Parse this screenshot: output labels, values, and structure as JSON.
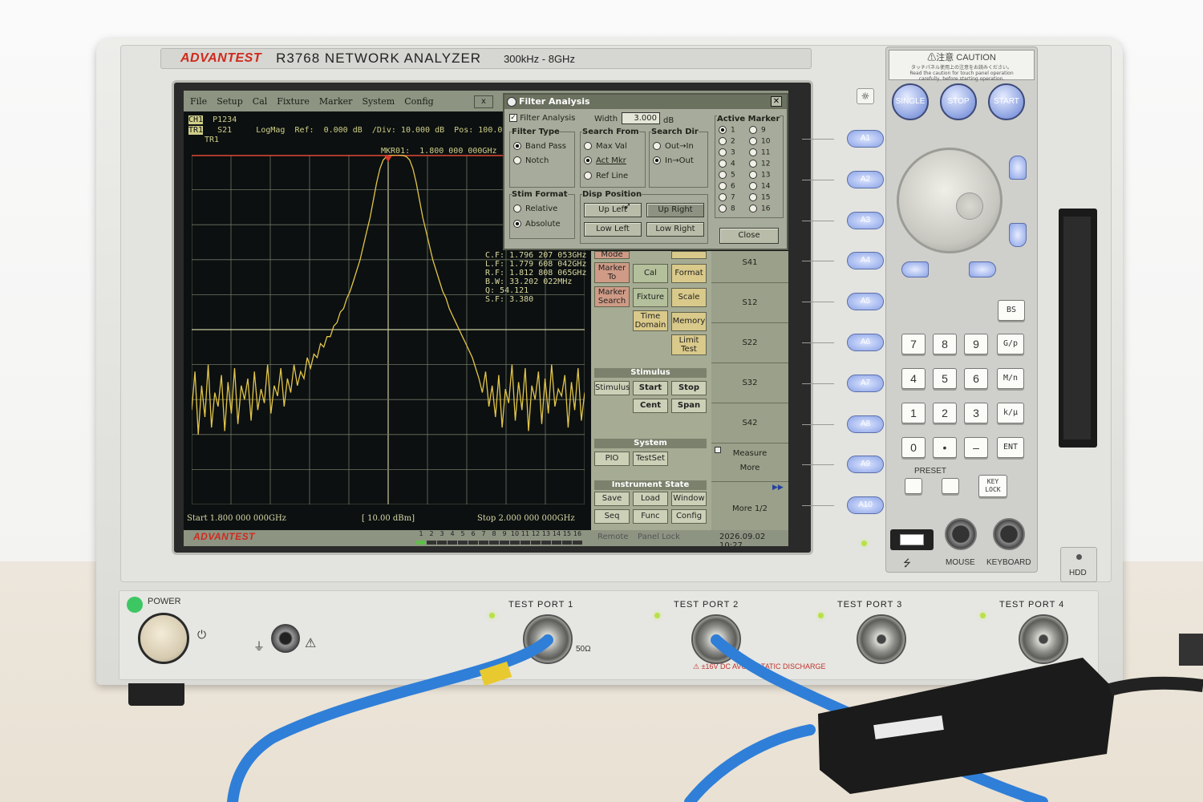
{
  "brand": "ADVANTEST",
  "model": "R3768 NETWORK ANALYZER",
  "freq_range": "300kHz - 8GHz",
  "menu": [
    "File",
    "Setup",
    "Cal",
    "Fixture",
    "Marker",
    "System",
    "Config"
  ],
  "menu_close": "x",
  "status": {
    "ch": "CH1",
    "pwr": "P1234",
    "tr": "TR1",
    "param": "S21",
    "fmt": "LogMag",
    "ref": "Ref:  0.000 dB",
    "div": "/Div: 10.000 dB",
    "pos": "Pos: 100.0 %",
    "tr_label": "TR1",
    "marker": "MKR01:  1.800 000 000GHz"
  },
  "stats": [
    "C.F:  1.796 207 053GHz",
    "L.F:  1.779 608 042GHz",
    "R.F:  1.812 808 065GHz",
    "B.W:     33.202 022MHz",
    "Q:    54.121",
    "S.F:     3.380"
  ],
  "bottom": {
    "start": "Start   1.800 000 000GHz",
    "power": "[ 10.00 dBm]",
    "stop": "Stop   2.000 000 000GHz",
    "channels": [
      "1",
      "2",
      "3",
      "4",
      "5",
      "6",
      "7",
      "8",
      "9",
      "10",
      "11",
      "12",
      "13",
      "14",
      "15",
      "16"
    ],
    "remote": "Remote",
    "panel_lock": "Panel Lock",
    "datetime": "2026.09.02  10:27"
  },
  "dialog": {
    "title": "Filter Analysis",
    "enable": "Filter Analysis",
    "width_label": "Width",
    "width_value": "3.000",
    "width_unit": "dB",
    "filter_type": "Filter Type",
    "band_pass": "Band Pass",
    "notch": "Notch",
    "search_from": "Search From",
    "max_val": "Max Val",
    "act_mkr": "Act Mkr",
    "ref_line": "Ref Line",
    "search_dir": "Search Dir",
    "out_in": "Out→In",
    "in_out": "In→Out",
    "stim_format": "Stim Format",
    "relative": "Relative",
    "absolute": "Absolute",
    "disp_position": "Disp Position",
    "up_left": "Up Left",
    "up_right": "Up Right",
    "low_left": "Low Left",
    "low_right": "Low Right",
    "active_marker": "Active Marker",
    "markers_left": [
      "1",
      "2",
      "3",
      "4",
      "5",
      "6",
      "7",
      "8"
    ],
    "markers_right": [
      "9",
      "10",
      "11",
      "12",
      "13",
      "14",
      "15",
      "16"
    ],
    "close": "Close"
  },
  "softkeys": {
    "mode": "Mode",
    "marker_to": "Marker To",
    "marker_search": "Marker Search",
    "cal": "Cal",
    "fixture": "Fixture",
    "time_domain": "Time Domain",
    "format": "Format",
    "scale": "Scale",
    "memory": "Memory",
    "limit_test": "Limit Test",
    "stimulus_head": "Stimulus",
    "stimulus": "Stimulus",
    "start": "Start",
    "stop": "Stop",
    "cent": "Cent",
    "span": "Span",
    "system_head": "System",
    "pio": "PIO",
    "testset": "TestSet",
    "inst_head": "Instrument State",
    "save": "Save",
    "load": "Load",
    "window": "Window",
    "seq": "Seq",
    "func": "Func",
    "config": "Config",
    "sparams": [
      "S41",
      "S12",
      "S22",
      "S32",
      "S42"
    ],
    "measure": "Measure",
    "more": "More",
    "more_page": "More 1/2"
  },
  "akeys": [
    "A1",
    "A2",
    "A3",
    "A4",
    "A5",
    "A6",
    "A7",
    "A8",
    "A9",
    "A10"
  ],
  "panel": {
    "caution_title": "⚠注意 CAUTION",
    "caution_jp": "タッチパネル使用上の注意をお読みください。",
    "caution_en1": "Read the caution for touch panel operation",
    "caution_en2": "carefully, before starting operation.",
    "single": "SINGLE",
    "stop": "STOP",
    "start": "START",
    "bs": "BS",
    "keys": [
      "7",
      "8",
      "9",
      "G/p",
      "4",
      "5",
      "6",
      "M/n",
      "1",
      "2",
      "3",
      "k/μ",
      "0",
      "•",
      "–",
      "ENT"
    ],
    "preset": "PRESET",
    "key_lock": "KEY LOCK",
    "mouse": "MOUSE",
    "keyboard": "KEYBOARD",
    "hdd": "HDD"
  },
  "front": {
    "power": "POWER",
    "port1": "TEST  PORT  1",
    "port2": "TEST  PORT  2",
    "port3": "TEST  PORT  3",
    "port4": "TEST  PORT  4",
    "ohm": "50Ω",
    "warning": "±16V DC    AVOID  STATIC  DISCHARGE"
  },
  "chart_data": {
    "type": "line",
    "x_start_ghz": 1.8,
    "x_stop_ghz": 2.0,
    "ylim": [
      -100,
      0
    ],
    "xlim": [
      1.8,
      2.0
    ],
    "grid": true,
    "series": [
      {
        "values": [
          -73,
          -62,
          -80,
          -66,
          -75,
          -60,
          -78,
          -68,
          -72,
          -63,
          -79,
          -65,
          -74,
          -61,
          -77,
          -66,
          -70,
          -64,
          -76,
          -62,
          -73,
          -67,
          -71,
          -60,
          -74,
          -66,
          -69,
          -61,
          -72,
          -64,
          -68,
          -60,
          -66,
          -62,
          -64,
          -58,
          -61,
          -57,
          -58,
          -54,
          -55,
          -52,
          -52,
          -49,
          -48,
          -45,
          -44,
          -41,
          -39,
          -36,
          -33,
          -30,
          -26,
          -22,
          -18,
          -13,
          -8,
          -4,
          -1.5,
          -0.5,
          -0.2,
          -0.1,
          0,
          -0.1,
          -0.2,
          -0.5,
          -1.5,
          -4,
          -8,
          -13,
          -18,
          -22,
          -26,
          -30,
          -33,
          -36,
          -39,
          -41,
          -44,
          -46,
          -48,
          -50,
          -52,
          -54,
          -56,
          -58,
          -61,
          -64,
          -68,
          -62,
          -72,
          -66,
          -75,
          -63,
          -78,
          -67,
          -71,
          -60,
          -76,
          -65,
          -73,
          -61,
          -79,
          -66,
          -70,
          -62,
          -77,
          -64,
          -74,
          -60,
          -72,
          -67,
          -69,
          -63,
          -78,
          -65,
          -73,
          -61,
          -76,
          -68
        ]
      }
    ]
  }
}
